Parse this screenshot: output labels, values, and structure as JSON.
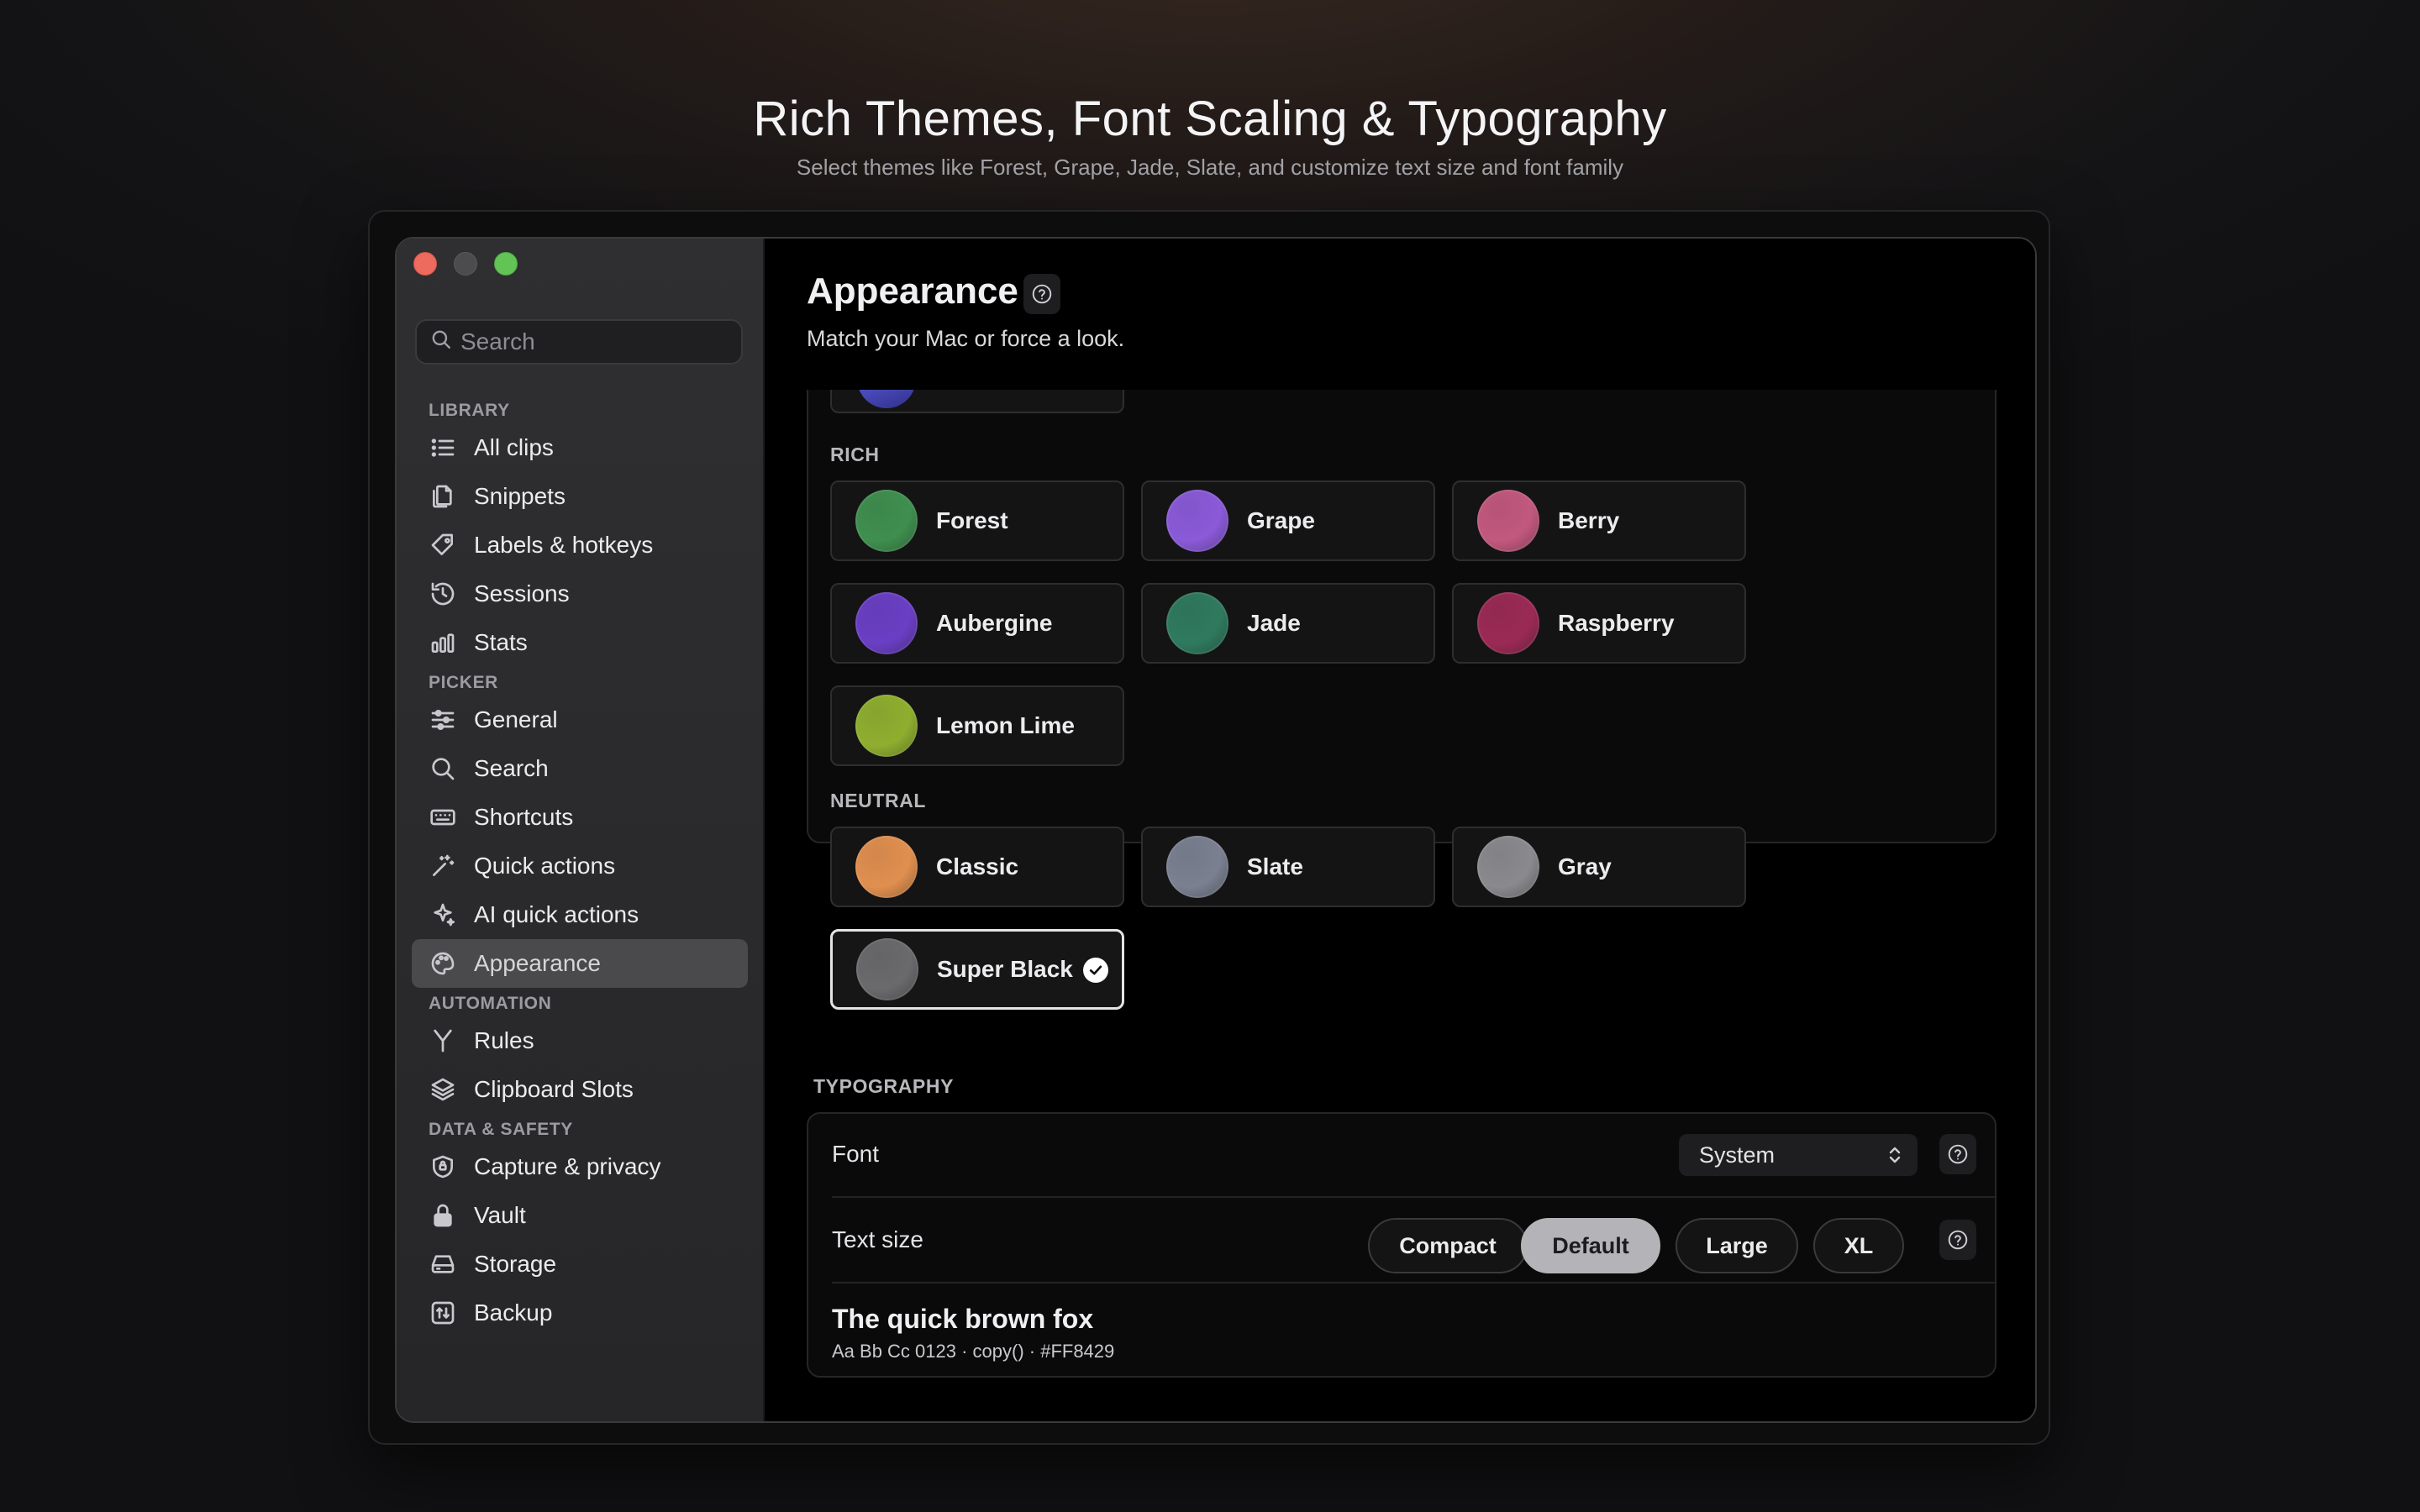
{
  "hero": {
    "title": "Rich Themes, Font Scaling & Typography",
    "subtitle": "Select themes like Forest, Grape, Jade, Slate, and customize text size and font family"
  },
  "sidebar": {
    "search_placeholder": "Search",
    "sections": [
      {
        "label": "LIBRARY",
        "items": [
          {
            "label": "All clips",
            "icon": "list-icon"
          },
          {
            "label": "Snippets",
            "icon": "documents-icon"
          },
          {
            "label": "Labels & hotkeys",
            "icon": "tag-icon"
          },
          {
            "label": "Sessions",
            "icon": "history-icon"
          },
          {
            "label": "Stats",
            "icon": "bar-chart-icon"
          }
        ]
      },
      {
        "label": "PICKER",
        "items": [
          {
            "label": "General",
            "icon": "sliders-icon"
          },
          {
            "label": "Search",
            "icon": "search-icon"
          },
          {
            "label": "Shortcuts",
            "icon": "keyboard-icon"
          },
          {
            "label": "Quick actions",
            "icon": "magic-wand-icon"
          },
          {
            "label": "AI quick actions",
            "icon": "sparkles-icon"
          },
          {
            "label": "Appearance",
            "icon": "palette-icon",
            "active": true
          }
        ]
      },
      {
        "label": "AUTOMATION",
        "items": [
          {
            "label": "Rules",
            "icon": "fork-icon"
          },
          {
            "label": "Clipboard Slots",
            "icon": "layers-icon"
          }
        ]
      },
      {
        "label": "DATA & SAFETY",
        "items": [
          {
            "label": "Capture & privacy",
            "icon": "shield-icon"
          },
          {
            "label": "Vault",
            "icon": "lock-icon"
          },
          {
            "label": "Storage",
            "icon": "drive-icon"
          },
          {
            "label": "Backup",
            "icon": "backup-icon"
          }
        ]
      }
    ]
  },
  "main": {
    "title": "Appearance",
    "subtitle": "Match your Mac or force a look.",
    "rich_label": "RICH",
    "neutral_label": "NEUTRAL",
    "rich_themes": [
      {
        "name": "Forest",
        "color": "#3f8f4f"
      },
      {
        "name": "Grape",
        "color": "#8a5ad8"
      },
      {
        "name": "Berry",
        "color": "#c2587e"
      },
      {
        "name": "Aubergine",
        "color": "#6a3fc4"
      },
      {
        "name": "Jade",
        "color": "#2f7a5e"
      },
      {
        "name": "Raspberry",
        "color": "#9a2a55"
      },
      {
        "name": "Lemon Lime",
        "color": "#8fae2f"
      }
    ],
    "neutral_themes": [
      {
        "name": "Classic",
        "color": "#e08f4f"
      },
      {
        "name": "Slate",
        "color": "#7a8090"
      },
      {
        "name": "Gray",
        "color": "#8a8a8e"
      },
      {
        "name": "Super Black",
        "color": "#6a6a6d",
        "selected": true
      }
    ],
    "typography": {
      "label": "TYPOGRAPHY",
      "font_label": "Font",
      "font_value": "System",
      "text_size_label": "Text size",
      "sizes": [
        "Compact",
        "Default",
        "Large",
        "XL"
      ],
      "active_size": "Default",
      "preview_title": "The quick brown fox",
      "preview_sub": "Aa Bb Cc 0123  ·  copy()  ·  #FF8429"
    }
  }
}
